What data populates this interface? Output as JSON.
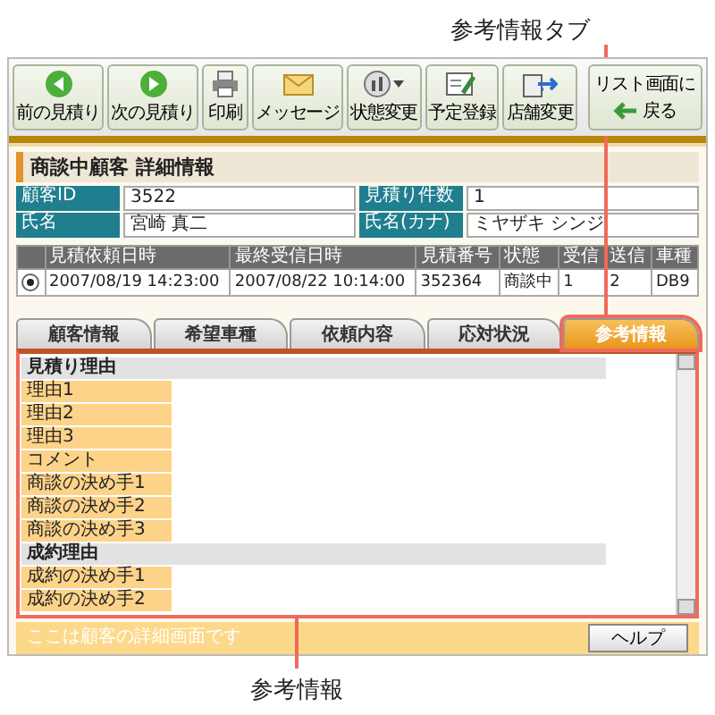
{
  "annotations": {
    "top_label": "参考情報タブ",
    "bottom_label": "参考情報"
  },
  "toolbar": {
    "buttons": [
      {
        "kind": "back",
        "label": "前の見積り"
      },
      {
        "kind": "forward",
        "label": "次の見積り"
      },
      {
        "kind": "print",
        "label": "印刷"
      },
      {
        "kind": "message",
        "label": "メッセージ"
      },
      {
        "kind": "status",
        "label": "状態変更"
      },
      {
        "kind": "schedule",
        "label": "予定登録"
      },
      {
        "kind": "store",
        "label": "店舗変更"
      }
    ],
    "return_button": {
      "line_1": "リスト画面に",
      "line_2": "戻る"
    }
  },
  "section_title": "商談中顧客  詳細情報",
  "info_fields": [
    {
      "label": "顧客ID",
      "value": "3522"
    },
    {
      "label": "見積り件数",
      "value": "1"
    },
    {
      "label": "氏名",
      "value": "宮崎 真二"
    },
    {
      "label": "氏名(カナ)",
      "value": "ミヤザキ シンジ"
    }
  ],
  "history": {
    "columns": [
      "見積依頼日時",
      "最終受信日時",
      "見積番号",
      "状態",
      "受信",
      "送信",
      "車種"
    ],
    "rows": [
      {
        "selected": true,
        "cells": [
          "2007/08/19 14:23:00",
          "2007/08/22 10:14:00",
          "352364",
          "商談中",
          "1",
          "2",
          "DB9"
        ]
      }
    ]
  },
  "tabs": [
    {
      "label": "顧客情報",
      "selected": false
    },
    {
      "label": "希望車種",
      "selected": false
    },
    {
      "label": "依頼内容",
      "selected": false
    },
    {
      "label": "応対状況",
      "selected": false
    },
    {
      "label": "参考情報",
      "selected": true
    }
  ],
  "panel_rows": [
    {
      "kind": "section",
      "label": "見積り理由"
    },
    {
      "kind": "field",
      "label": "理由1"
    },
    {
      "kind": "field",
      "label": "理由2"
    },
    {
      "kind": "field",
      "label": "理由3"
    },
    {
      "kind": "field",
      "label": "コメント"
    },
    {
      "kind": "field",
      "label": "商談の決め手1"
    },
    {
      "kind": "field",
      "label": "商談の決め手2"
    },
    {
      "kind": "field",
      "label": "商談の決め手3"
    },
    {
      "kind": "section",
      "label": "成約理由"
    },
    {
      "kind": "field",
      "label": "成約の決め手1"
    },
    {
      "kind": "field",
      "label": "成約の決め手2"
    }
  ],
  "status_bar": {
    "text": "ここは顧客の詳細画面です",
    "help_button": "ヘルプ"
  }
}
